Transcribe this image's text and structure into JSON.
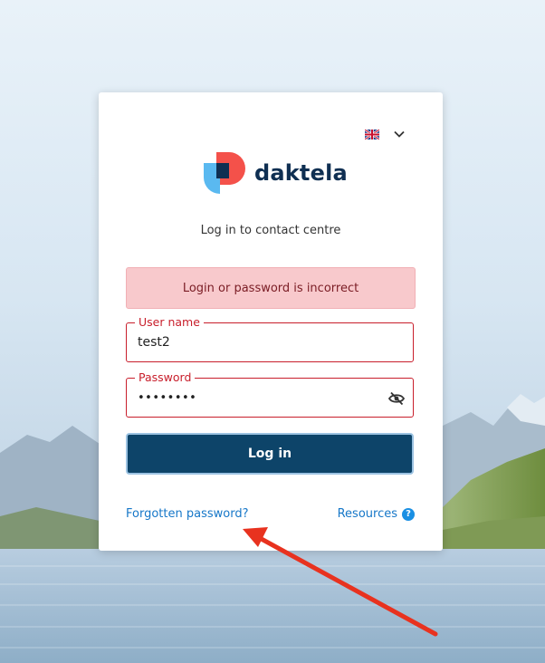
{
  "language": {
    "flag": "uk-flag-icon",
    "chevron": "chevron-down-icon"
  },
  "brand": {
    "name": "daktela"
  },
  "subtitle": "Log in to contact centre",
  "error": "Login or password is incorrect",
  "form": {
    "username": {
      "label": "User name",
      "value": "test2"
    },
    "password": {
      "label": "Password",
      "value": "••••••••",
      "toggle_icon": "eye-slash-icon"
    },
    "login_button": "Log in"
  },
  "links": {
    "forgot": "Forgotten password?",
    "resources": "Resources",
    "help_glyph": "?"
  },
  "colors": {
    "primary": "#0d4469",
    "error_border": "#c81e2b",
    "error_bg": "#f8c9cc",
    "link": "#1677c8",
    "annotation_arrow": "#e8321f"
  }
}
